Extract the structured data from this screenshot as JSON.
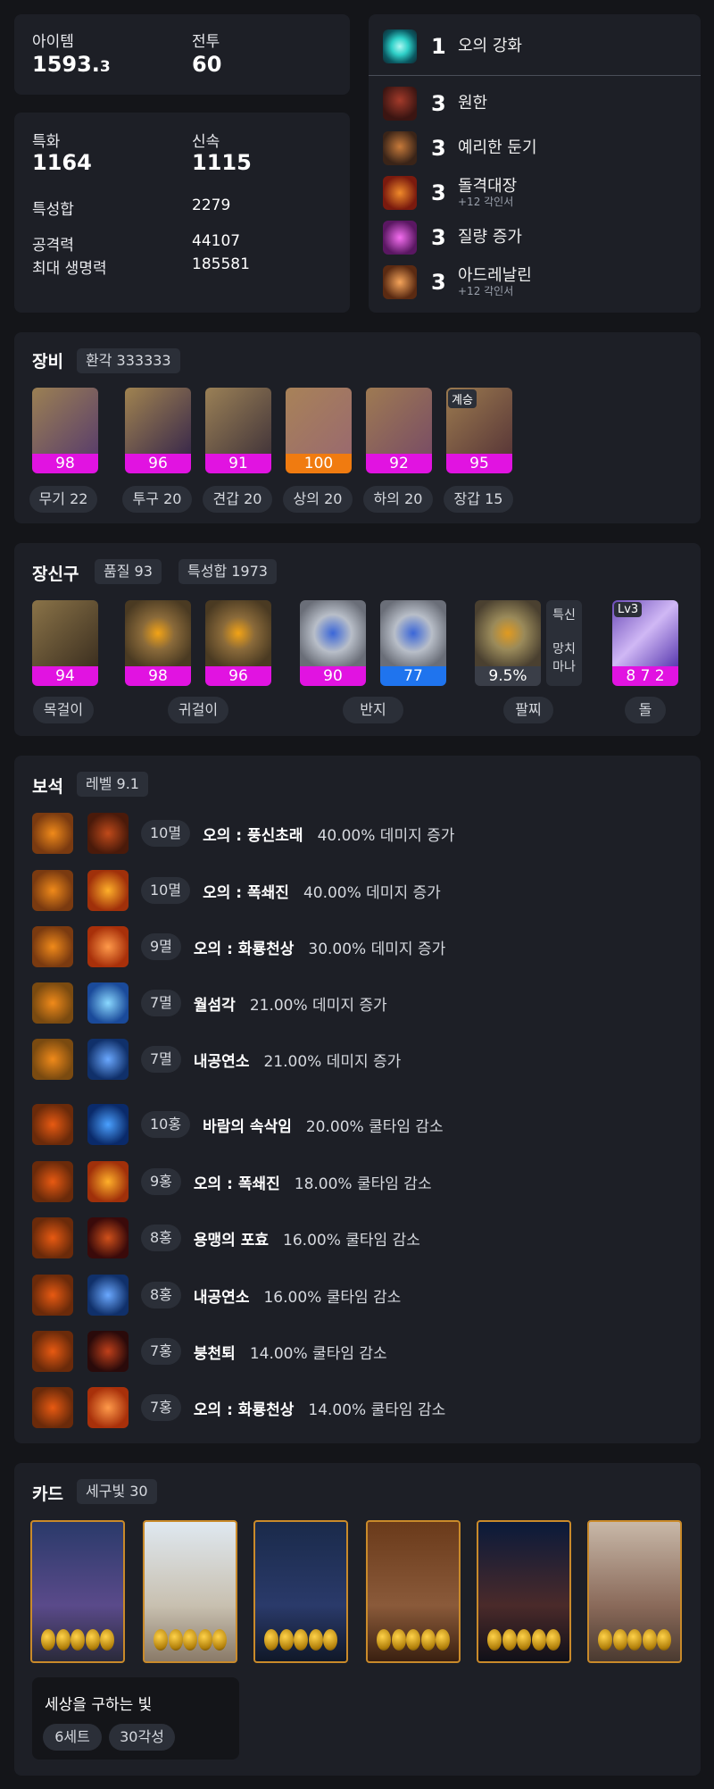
{
  "stats": {
    "item_label": "아이템",
    "item_value_main": "1593.",
    "item_value_decimal": "3",
    "combat_label": "전투",
    "combat_value": "60",
    "crit_label": "특화",
    "crit_value": "1164",
    "swift_label": "신속",
    "swift_value": "1115",
    "total_label": "특성합",
    "total_value": "2279",
    "atk_label": "공격력",
    "atk_value": "44107",
    "hp_label": "최대 생명력",
    "hp_value": "185581"
  },
  "engravings": {
    "special": {
      "level": "1",
      "name": "오의 강화"
    },
    "items": [
      {
        "level": "3",
        "name": "원한",
        "sub": ""
      },
      {
        "level": "3",
        "name": "예리한 둔기",
        "sub": ""
      },
      {
        "level": "3",
        "name": "돌격대장",
        "sub": "+12 각인서"
      },
      {
        "level": "3",
        "name": "질량 증가",
        "sub": ""
      },
      {
        "level": "3",
        "name": "아드레날린",
        "sub": "+12 각인서"
      }
    ]
  },
  "equipment": {
    "title": "장비",
    "badge": "환각 333333",
    "items": [
      {
        "quality": "98",
        "label": "무기 22",
        "color": "#e113e1"
      },
      {
        "quality": "96",
        "label": "투구 20",
        "color": "#e113e1"
      },
      {
        "quality": "91",
        "label": "견갑 20",
        "color": "#e113e1"
      },
      {
        "quality": "100",
        "label": "상의 20",
        "color": "#f07b10"
      },
      {
        "quality": "92",
        "label": "하의 20",
        "color": "#e113e1"
      },
      {
        "quality": "95",
        "label": "장갑 15",
        "color": "#e113e1",
        "tag": "계승"
      }
    ]
  },
  "accessories": {
    "title": "장신구",
    "quality_badge": "품질 93",
    "stat_badge": "특성합 1973",
    "necklace": {
      "quality": "94",
      "label": "목걸이"
    },
    "earrings": [
      {
        "quality": "98"
      },
      {
        "quality": "96"
      }
    ],
    "earring_label": "귀걸이",
    "rings": [
      {
        "quality": "90"
      },
      {
        "quality": "77"
      }
    ],
    "ring_label": "반지",
    "bracelet": {
      "value": "9.5%",
      "label": "팔찌",
      "opt1": "특신",
      "opt2": "망치",
      "opt3": "마나"
    },
    "stone": {
      "level": "Lv3",
      "value": "8 7 2",
      "label": "돌"
    }
  },
  "gems": {
    "title": "보석",
    "badge": "레벨 9.1",
    "items": [
      {
        "level": "10멸",
        "skill": "오의 : 풍신초래",
        "effect": "40.00% 데미지 증가"
      },
      {
        "level": "10멸",
        "skill": "오의 : 폭쇄진",
        "effect": "40.00% 데미지 증가"
      },
      {
        "level": "9멸",
        "skill": "오의 : 화룡천상",
        "effect": "30.00% 데미지 증가"
      },
      {
        "level": "7멸",
        "skill": "월섬각",
        "effect": "21.00% 데미지 증가"
      },
      {
        "level": "7멸",
        "skill": "내공연소",
        "effect": "21.00% 데미지 증가"
      },
      {
        "level": "10홍",
        "skill": "바람의 속삭임",
        "effect": "20.00% 쿨타임 감소"
      },
      {
        "level": "9홍",
        "skill": "오의 : 폭쇄진",
        "effect": "18.00% 쿨타임 감소"
      },
      {
        "level": "8홍",
        "skill": "용맹의 포효",
        "effect": "16.00% 쿨타임 감소"
      },
      {
        "level": "8홍",
        "skill": "내공연소",
        "effect": "16.00% 쿨타임 감소"
      },
      {
        "level": "7홍",
        "skill": "붕천퇴",
        "effect": "14.00% 쿨타임 감소"
      },
      {
        "level": "7홍",
        "skill": "오의 : 화룡천상",
        "effect": "14.00% 쿨타임 감소"
      }
    ]
  },
  "cards": {
    "title": "카드",
    "badge": "세구빛 30",
    "set_name": "세상을 구하는 빛",
    "set_count": "6세트",
    "set_awaken": "30각성"
  }
}
